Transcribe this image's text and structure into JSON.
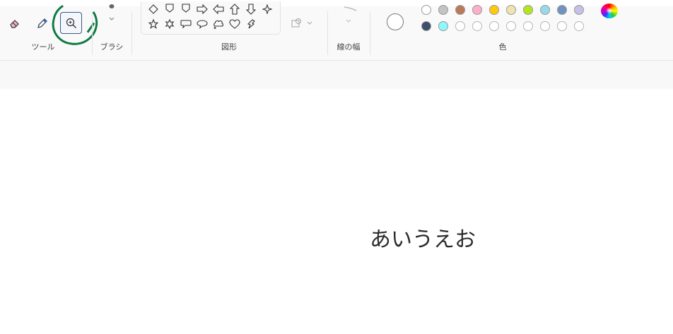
{
  "groups": {
    "tools_label": "ツール",
    "brush_label": "ブラシ",
    "shapes_label": "図形",
    "stroke_label": "線の幅",
    "color_label": "色"
  },
  "tools": [
    {
      "name": "eraser-icon"
    },
    {
      "name": "pencil-icon"
    },
    {
      "name": "magnifier-icon",
      "active": true
    }
  ],
  "shapes_row1": [
    "diamond-icon",
    "pentagon-icon",
    "hexagon-icon",
    "arrow-right-icon",
    "arrow-left-icon",
    "arrow-up-icon",
    "arrow-down-icon",
    "star4-icon"
  ],
  "shapes_row2": [
    "star5-icon",
    "star6-icon",
    "callout-rect-icon",
    "callout-oval-icon",
    "callout-cloud-icon",
    "heart-icon",
    "lightning-icon"
  ],
  "colors": {
    "current": "#ffffff",
    "row1": [
      "#ffffff",
      "#c3c3c3",
      "#b97a57",
      "#ffaec9",
      "#ffc90e",
      "#efe4b0",
      "#b5e61d",
      "#99d9ea",
      "#7092be",
      "#c8bfe7"
    ],
    "row2": [
      "#3e4e6c",
      "#8cf8ff",
      "#ffffff",
      "#ffffff",
      "#ffffff",
      "#ffffff",
      "#ffffff",
      "#ffffff",
      "#ffffff",
      "#ffffff"
    ]
  },
  "canvas": {
    "text": "あいうえお"
  }
}
